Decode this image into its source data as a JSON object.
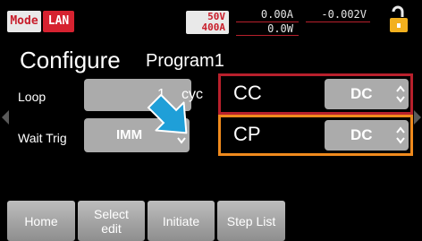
{
  "status_bar": {
    "mode_label": "Mode",
    "interface_label": "LAN",
    "voltage_range": "50V",
    "current_range": "400A",
    "current_reading": "0.00A",
    "voltage_reading": "-0.002V",
    "power_reading": "0.0W"
  },
  "header": {
    "title": "Configure",
    "program": "Program1"
  },
  "settings": {
    "loop": {
      "label": "Loop",
      "value": "1",
      "unit": "cyc"
    },
    "wait_trig": {
      "label": "Wait Trig",
      "value": "IMM"
    }
  },
  "modes": [
    {
      "label": "CC",
      "value": "DC"
    },
    {
      "label": "CP",
      "value": "DC"
    }
  ],
  "softkeys": {
    "home": "Home",
    "select_edit_line1": "Select",
    "select_edit_line2": "edit",
    "initiate": "Initiate",
    "step_list": "Step List"
  },
  "icons": {
    "lock": "unlocked-padlock-icon",
    "pointer": "pointer-arrow-icon",
    "spin": "up-down-spinner-icon",
    "page_left": "left-arrow-icon",
    "page_right": "right-arrow-icon"
  },
  "colors": {
    "background": "#000000",
    "alert_red": "#d62230",
    "active_border": "#ef8a1d",
    "inactive_border": "#b8202c",
    "field_gray": "#ababab",
    "lock_yellow": "#f2b01e",
    "pointer_blue": "#1f9fd8"
  }
}
